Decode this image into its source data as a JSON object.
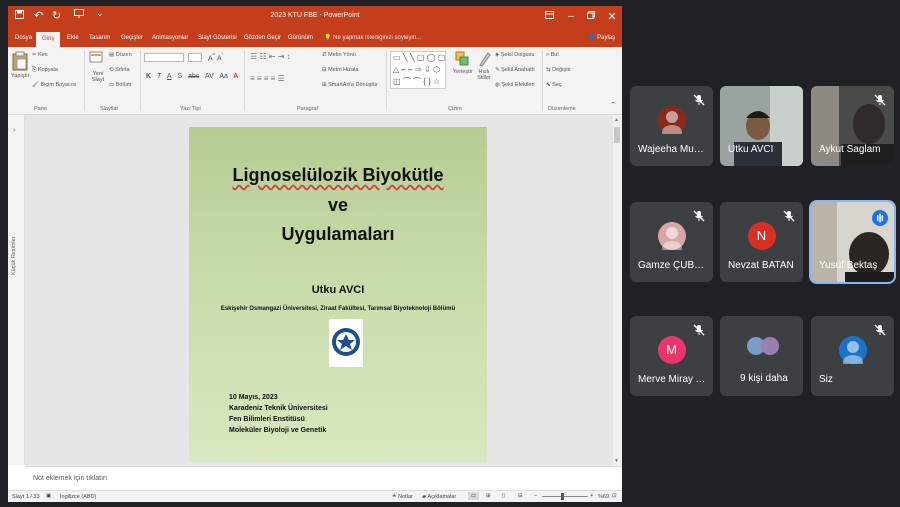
{
  "window": {
    "title": "2023 KTU FBE - PowerPoint",
    "quick_access": [
      "save",
      "undo",
      "redo",
      "present"
    ],
    "controls": [
      "ribbon-options",
      "minimize",
      "restore",
      "close"
    ]
  },
  "ribbon": {
    "tabs": [
      "Dosya",
      "Giriş",
      "Ekle",
      "Tasarım",
      "Geçişler",
      "Animasyonlar",
      "Slayt Gösterisi",
      "Gözden Geçir",
      "Görünüm"
    ],
    "active_tab": "Giriş",
    "tell_me": "Ne yapmak istediğinizi söyleyin...",
    "share": "Paylaş",
    "groups": {
      "pano": {
        "label": "Pano",
        "paste": "Yapıştır",
        "cut": "Kes",
        "copy": "Kopyala",
        "format_painter": "Biçim Boyacısı"
      },
      "slaytlar": {
        "label": "Slaytlar",
        "new_slide": "Yeni Slayt",
        "layout": "Düzen",
        "reset": "Sıfırla",
        "section": "Bölüm"
      },
      "yazi_tipi": {
        "label": "Yazı Tipi",
        "format_buttons": [
          "K",
          "T",
          "A",
          "S",
          "abc",
          "AV",
          "Aa",
          "A"
        ]
      },
      "paragraf": {
        "label": "Paragraf",
        "text_direction": "Metin Yönü",
        "align_text": "Metni Hizala",
        "smartart": "SmartArt'a Dönüştür"
      },
      "cizim": {
        "label": "Çizim",
        "arrange": "Yerleştir",
        "quick_styles": "Hızlı Stiller",
        "shape_fill": "Şekil Dolgusu",
        "shape_outline": "Şekil Anahattı",
        "shape_effects": "Şekil Efektleri"
      },
      "duzenleme": {
        "label": "Düzenleme",
        "find": "Bul",
        "replace": "Değiştir",
        "select": "Seç"
      }
    }
  },
  "left_pane": {
    "label": "Küçük Resimler"
  },
  "slide": {
    "title_line1": "Lignoselülozik Biyokütle",
    "title_line2": "ve",
    "title_line3": "Uygulamaları",
    "author": "Utku AVCI",
    "affiliation": "Eskişehir Osmangazi Üniversitesi, Ziraat Fakültesi, Tarımsal Biyoteknoloji Bölümü",
    "date": "10 Mayıs, 2023",
    "venue_line1": "Karadeniz Teknik Üniversitesi",
    "venue_line2": "Fen Bilimleri Enstitüsü",
    "venue_line3": "Moleküler Biyoloji ve Genetik"
  },
  "notes": {
    "placeholder": "Not eklemek için tıklatın"
  },
  "status": {
    "slide_info": "Slayt 1 / 33",
    "language": "İngilizce (ABD)",
    "notes": "Notlar",
    "comments": "Açıklamalar",
    "zoom": "%69"
  },
  "meeting": {
    "participants": [
      {
        "name": "Wajeeha Muna...",
        "kind": "avatar-image",
        "color": "#8b2a1a",
        "muted": true
      },
      {
        "name": "Utku AVCI",
        "kind": "video",
        "muted": false
      },
      {
        "name": "Aykut Saglam",
        "kind": "video",
        "muted": true
      },
      {
        "name": "Gamze ÇUBUK...",
        "kind": "avatar-image",
        "color": "#d9a6a6",
        "muted": true
      },
      {
        "name": "Nevzat BATAN",
        "kind": "initial",
        "initial": "N",
        "color": "#d93025",
        "muted": true
      },
      {
        "name": "Yusuf Bektaş",
        "kind": "video",
        "muted": false,
        "speaking": true
      },
      {
        "name": "Merve Miray A...",
        "kind": "initial",
        "initial": "M",
        "color": "#e8356d",
        "muted": true
      },
      {
        "name": "9 kişi daha",
        "kind": "group"
      },
      {
        "name": "Siz",
        "kind": "avatar-image",
        "color": "#1a73c9",
        "muted": true
      }
    ]
  }
}
